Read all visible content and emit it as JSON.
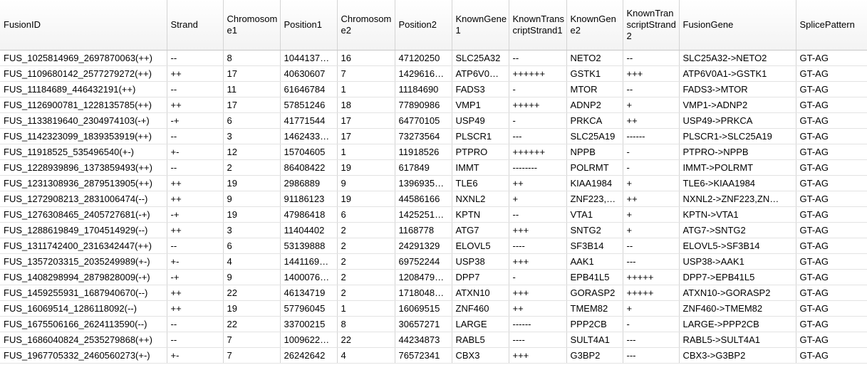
{
  "table": {
    "columns": [
      "FusionID",
      "Strand",
      "Chromosome1",
      "Position1",
      "Chromosome2",
      "Position2",
      "KnownGene1",
      "KnownTranscriptStrand1",
      "KnownGene2",
      "KnownTranscriptStrand2",
      "FusionGene",
      "SplicePattern"
    ],
    "rows": [
      [
        "FUS_1025814969_2697870063(++)",
        "--",
        "8",
        "1044137…",
        "16",
        "47120250",
        "SLC25A32",
        "--",
        "NETO2",
        "--",
        "SLC25A32->NETO2",
        "GT-AG"
      ],
      [
        "FUS_1109680142_2577279272(++)",
        "++",
        "17",
        "40630607",
        "7",
        "1429616…",
        "ATP6V0…",
        "++++++",
        "GSTK1",
        "+++",
        "ATP6V0A1->GSTK1",
        "GT-AG"
      ],
      [
        "FUS_11184689_446432191(++)",
        "--",
        "11",
        "61646784",
        "1",
        "11184690",
        "FADS3",
        "-",
        "MTOR",
        "--",
        "FADS3->MTOR",
        "GT-AG"
      ],
      [
        "FUS_1126900781_1228135785(++)",
        "++",
        "17",
        "57851246",
        "18",
        "77890986",
        "VMP1",
        "+++++",
        "ADNP2",
        "+",
        "VMP1->ADNP2",
        "GT-AG"
      ],
      [
        "FUS_1133819640_2304974103(-+)",
        "-+",
        "6",
        "41771544",
        "17",
        "64770105",
        "USP49",
        "-",
        "PRKCA",
        "++",
        "USP49->PRKCA",
        "GT-AG"
      ],
      [
        "FUS_1142323099_1839353919(++)",
        "--",
        "3",
        "1462433…",
        "17",
        "73273564",
        "PLSCR1",
        "---",
        "SLC25A19",
        "------",
        "PLSCR1->SLC25A19",
        "GT-AG"
      ],
      [
        "FUS_11918525_535496540(+-)",
        "+-",
        "12",
        "15704605",
        "1",
        "11918526",
        "PTPRO",
        "++++++",
        "NPPB",
        "-",
        "PTPRO->NPPB",
        "GT-AG"
      ],
      [
        "FUS_1228939896_1373859493(++)",
        "--",
        "2",
        "86408422",
        "19",
        "617849",
        "IMMT",
        "--------",
        "POLRMT",
        "-",
        "IMMT->POLRMT",
        "GT-AG"
      ],
      [
        "FUS_1231308936_2879513905(++)",
        "++",
        "19",
        "2986889",
        "9",
        "1396935…",
        "TLE6",
        "++",
        "KIAA1984",
        "+",
        "TLE6->KIAA1984",
        "GT-AG"
      ],
      [
        "FUS_1272908213_2831006474(--)",
        "++",
        "9",
        "91186123",
        "19",
        "44586166",
        "NXNL2",
        "+",
        "ZNF223,…",
        "++",
        "NXNL2->ZNF223,ZN…",
        "GT-AG"
      ],
      [
        "FUS_1276308465_2405727681(-+)",
        "-+",
        "19",
        "47986418",
        "6",
        "1425251…",
        "KPTN",
        "--",
        "VTA1",
        "+",
        "KPTN->VTA1",
        "GT-AG"
      ],
      [
        "FUS_1288619849_1704514929(--)",
        "++",
        "3",
        "11404402",
        "2",
        "1168778",
        "ATG7",
        "+++",
        "SNTG2",
        "+",
        "ATG7->SNTG2",
        "GT-AG"
      ],
      [
        "FUS_1311742400_2316342447(++)",
        "--",
        "6",
        "53139888",
        "2",
        "24291329",
        "ELOVL5",
        "----",
        "SF3B14",
        "--",
        "ELOVL5->SF3B14",
        "GT-AG"
      ],
      [
        "FUS_1357203315_2035249989(+-)",
        "+-",
        "4",
        "1441169…",
        "2",
        "69752244",
        "USP38",
        "+++",
        "AAK1",
        "---",
        "USP38->AAK1",
        "GT-AG"
      ],
      [
        "FUS_1408298994_2879828009(-+)",
        "-+",
        "9",
        "1400076…",
        "2",
        "1208479…",
        "DPP7",
        "-",
        "EPB41L5",
        "+++++",
        "DPP7->EPB41L5",
        "GT-AG"
      ],
      [
        "FUS_1459255931_1687940670(--)",
        "++",
        "22",
        "46134719",
        "2",
        "1718048…",
        "ATXN10",
        "+++",
        "GORASP2",
        "+++++",
        "ATXN10->GORASP2",
        "GT-AG"
      ],
      [
        "FUS_16069514_1286118092(--)",
        "++",
        "19",
        "57796045",
        "1",
        "16069515",
        "ZNF460",
        "++",
        "TMEM82",
        "+",
        "ZNF460->TMEM82",
        "GT-AG"
      ],
      [
        "FUS_1675506166_2624113590(--)",
        "--",
        "22",
        "33700215",
        "8",
        "30657271",
        "LARGE",
        "------",
        "PPP2CB",
        "-",
        "LARGE->PPP2CB",
        "GT-AG"
      ],
      [
        "FUS_1686040824_2535279868(++)",
        "--",
        "7",
        "1009622…",
        "22",
        "44234873",
        "RABL5",
        "----",
        "SULT4A1",
        "---",
        "RABL5->SULT4A1",
        "GT-AG"
      ],
      [
        "FUS_1967705332_2460560273(+-)",
        "+-",
        "7",
        "26242642",
        "4",
        "76572341",
        "CBX3",
        "+++",
        "G3BP2",
        "---",
        "CBX3->G3BP2",
        "GT-AG"
      ]
    ]
  }
}
